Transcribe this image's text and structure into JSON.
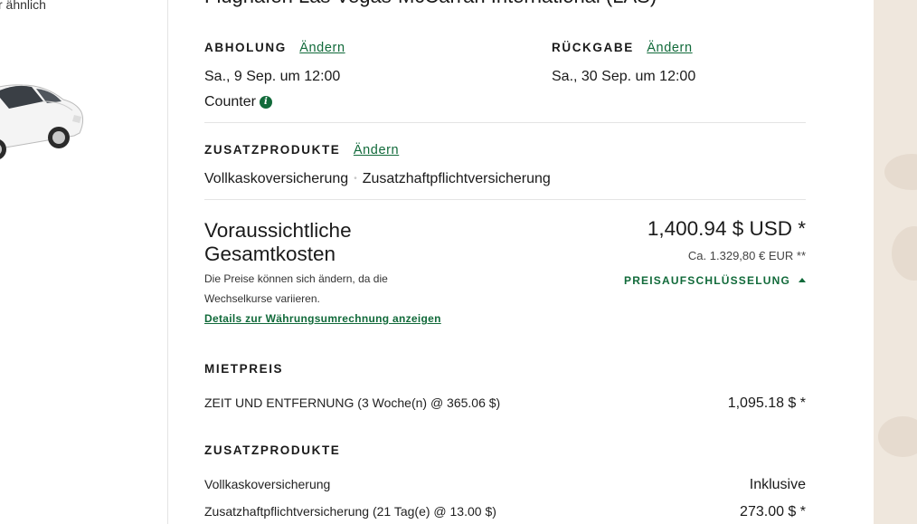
{
  "left": {
    "similar_text": "r ähnlich"
  },
  "location": {
    "title": "Flughafen Las Vegas-McCarran International (LAS)"
  },
  "pickup": {
    "label": "ABHOLUNG",
    "change": "Ändern",
    "datetime": "Sa., 9 Sep. um 12:00",
    "type": "Counter"
  },
  "return": {
    "label": "RÜCKGABE",
    "change": "Ändern",
    "datetime": "Sa., 30 Sep. um 12:00"
  },
  "extras": {
    "label": "ZUSATZPRODUKTE",
    "change": "Ändern",
    "items": [
      "Vollkaskoversicherung",
      "Zusatzhaftpflichtversicherung"
    ]
  },
  "total": {
    "title_line1": "Voraussichtliche",
    "title_line2": "Gesamtkosten",
    "note_line1": "Die Preise können sich ändern, da die",
    "note_line2": "Wechselkurse variieren.",
    "currency_link": "Details zur Währungsumrechnung anzeigen",
    "amount_usd": "1,400.94 $ USD *",
    "amount_eur": "Ca. 1.329,80 € EUR **",
    "breakdown_label": "PREISAUFSCHLÜSSELUNG"
  },
  "rental_price": {
    "heading": "MIETPREIS",
    "line_label": "ZEIT UND ENTFERNUNG (3 Woche(n) @ 365.06 $)",
    "line_value": "1,095.18 $ *"
  },
  "extras_breakdown": {
    "heading": "ZUSATZPRODUKTE",
    "lines": [
      {
        "label": "Vollkaskoversicherung",
        "value": "Inklusive"
      },
      {
        "label": "Zusatzhaftpflichtversicherung (21 Tag(e) @ 13.00 $)",
        "value": "273.00 $ *"
      }
    ]
  },
  "colors": {
    "accent": "#116a3a",
    "divider": "#e4e4e4",
    "deco": "#efe7dd"
  }
}
